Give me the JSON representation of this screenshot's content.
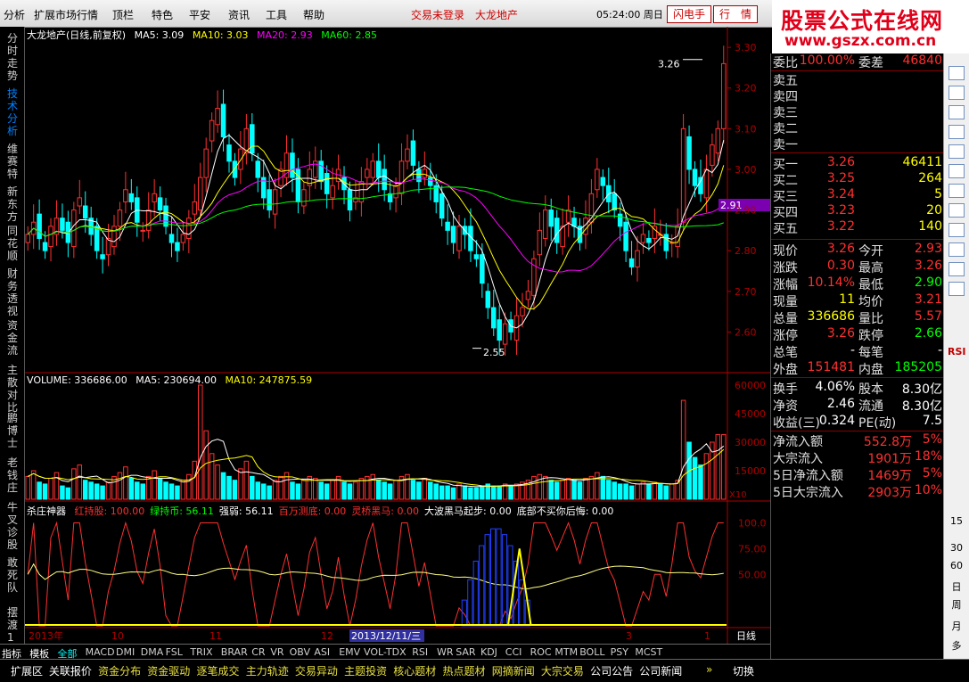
{
  "menu": {
    "items": [
      "分析",
      "扩展市场行情",
      "顶栏",
      "特色",
      "平安",
      "资讯",
      "工具",
      "帮助"
    ],
    "status_not_logged": "交易未登录",
    "stock_name_top": "大龙地产",
    "clock": "05:24:00 周日",
    "btn_flash": "闪电手",
    "btn_quote": "行　情"
  },
  "logo": {
    "cn": "股票公式在线网",
    "url": "www.gszx.com.cn"
  },
  "left_tabs": [
    {
      "label": "分时走势",
      "active": false
    },
    {
      "label": "技术分析",
      "active": true
    },
    {
      "label": "维赛特",
      "active": false
    },
    {
      "label": "新东方",
      "active": false
    },
    {
      "label": "同花顺",
      "active": false
    },
    {
      "label": "财务透视",
      "active": false
    },
    {
      "label": "资金流",
      "active": false
    },
    {
      "label": "主散对比",
      "active": false
    },
    {
      "label": "鹏博士",
      "active": false
    },
    {
      "label": "老钱庄",
      "active": false
    },
    {
      "label": "牛叉诊股",
      "active": false
    },
    {
      "label": "敢死队",
      "active": false
    },
    {
      "label": "摆渡1",
      "active": false
    }
  ],
  "price_panel": {
    "title": "大龙地产(日线,前复权)",
    "ma": [
      {
        "label": "MA5: 3.09",
        "color": "#ffffff"
      },
      {
        "label": "MA10: 3.03",
        "color": "#ffff00"
      },
      {
        "label": "MA20: 2.93",
        "color": "#ff00ff"
      },
      {
        "label": "MA60: 2.85",
        "color": "#00ff00"
      }
    ],
    "axis": [
      "3.30",
      "3.20",
      "3.10",
      "3.00",
      "2.91",
      "2.90",
      "2.80",
      "2.70",
      "2.60"
    ],
    "current": "2.91",
    "high_label": "3.26",
    "low_label": "2.55"
  },
  "volume_panel": {
    "title": "VOLUME: 336686.00",
    "ma5": "MA5: 230694.00",
    "ma10": "MA10: 247875.59",
    "axis": [
      "60000",
      "45000",
      "30000",
      "15000"
    ],
    "unit": "X10"
  },
  "indicator_panel": {
    "title": "杀庄神器",
    "items": [
      {
        "label": "红持股: 100.00",
        "color": "#ff3030"
      },
      {
        "label": "绿持币: 56.11",
        "color": "#00ff00"
      },
      {
        "label": "强弱: 56.11",
        "color": "#ffffff"
      },
      {
        "label": "百万测底: 0.00",
        "color": "#ff3030"
      },
      {
        "label": "灵桥黑马: 0.00",
        "color": "#ff3030"
      },
      {
        "label": "大波黑马起步: 0.00",
        "color": "#ffffff"
      },
      {
        "label": "底部不买你后悔: 0.00",
        "color": "#ffffff"
      }
    ],
    "axis": [
      "100.0",
      "75.00",
      "50.00"
    ]
  },
  "date_axis": {
    "labels": [
      "2013年",
      "10",
      "11",
      "12",
      "2013/12/11/三",
      "3",
      "1"
    ],
    "period": "日线"
  },
  "indicator_tabs": [
    "指标",
    "模板",
    "全部",
    "MACD",
    "DMI",
    "DMA",
    "FSL",
    "TRIX",
    "BRAR",
    "CR",
    "VR",
    "OBV",
    "ASI",
    "EMV",
    "VOL-TDX",
    "RSI",
    "WR",
    "SAR",
    "KDJ",
    "CCI",
    "ROC",
    "MTM",
    "BOLL",
    "PSY",
    "MCST"
  ],
  "info": {
    "sell_ratio": {
      "l1": "委比",
      "v1": "100.00%",
      "l2": "委差",
      "v2": "46840"
    },
    "sells": [
      "卖五",
      "卖四",
      "卖三",
      "卖二",
      "卖一"
    ],
    "buys": [
      {
        "l": "买一",
        "p": "3.26",
        "v": "46411"
      },
      {
        "l": "买二",
        "p": "3.25",
        "v": "264"
      },
      {
        "l": "买三",
        "p": "3.24",
        "v": "5"
      },
      {
        "l": "买四",
        "p": "3.23",
        "v": "20"
      },
      {
        "l": "买五",
        "p": "3.22",
        "v": "140"
      }
    ],
    "stats": [
      {
        "l1": "现价",
        "v1": "3.26",
        "c1": "#ff3030",
        "l2": "今开",
        "v2": "2.93",
        "c2": "#ff3030"
      },
      {
        "l1": "涨跌",
        "v1": "0.30",
        "c1": "#ff3030",
        "l2": "最高",
        "v2": "3.26",
        "c2": "#ff3030"
      },
      {
        "l1": "涨幅",
        "v1": "10.14%",
        "c1": "#ff3030",
        "l2": "最低",
        "v2": "2.90",
        "c2": "#00ff00"
      },
      {
        "l1": "现量",
        "v1": "11",
        "c1": "#ffff00",
        "l2": "均价",
        "v2": "3.21",
        "c2": "#ff3030"
      },
      {
        "l1": "总量",
        "v1": "336686",
        "c1": "#ffff00",
        "l2": "量比",
        "v2": "5.57",
        "c2": "#ff3030"
      },
      {
        "l1": "涨停",
        "v1": "3.26",
        "c1": "#ff3030",
        "l2": "跌停",
        "v2": "2.66",
        "c2": "#00ff00"
      },
      {
        "l1": "总笔",
        "v1": "-",
        "c1": "#ffffff",
        "l2": "每笔",
        "v2": "-",
        "c2": "#ffffff"
      },
      {
        "l1": "外盘",
        "v1": "151481",
        "c1": "#ff3030",
        "l2": "内盘",
        "v2": "185205",
        "c2": "#00ff00"
      }
    ],
    "stats2": [
      {
        "l1": "换手",
        "v1": "4.06%",
        "c1": "#ffffff",
        "l2": "股本",
        "v2": "8.30亿",
        "c2": "#ffffff"
      },
      {
        "l1": "净资",
        "v1": "2.46",
        "c1": "#ffffff",
        "l2": "流通",
        "v2": "8.30亿",
        "c2": "#ffffff"
      },
      {
        "l1": "收益(三)",
        "v1": "0.324",
        "c1": "#ffffff",
        "l2": "PE(动)",
        "v2": "7.5",
        "c2": "#ffffff"
      }
    ],
    "flows": [
      {
        "l": "净流入额",
        "v": "552.8万",
        "p": "5%"
      },
      {
        "l": "大宗流入",
        "v": "1901万",
        "p": "18%"
      },
      {
        "l": "5日净流入额",
        "v": "1469万",
        "p": "5%"
      },
      {
        "l": "5日大宗流入",
        "v": "2903万",
        "p": "10%"
      }
    ],
    "bottom_tabs": [
      "笔",
      "价",
      "细",
      "盘",
      "势",
      "指",
      "值",
      "筹"
    ]
  },
  "right_tools": [
    "RSI",
    "15",
    "30",
    "60",
    "日",
    "周",
    "月",
    "多"
  ],
  "bottom_bar": {
    "items": [
      "扩展区",
      "关联报价",
      "资金分布",
      "资金驱动",
      "逐笔成交",
      "主力轨迹",
      "交易异动",
      "主题投资",
      "核心题材",
      "热点题材",
      "网摘新闻",
      "大宗交易",
      "公司公告",
      "公司新闻"
    ],
    "more": "»",
    "switch": "切换"
  },
  "chart_data": {
    "type": "candlestick",
    "price_range": [
      2.5,
      3.32
    ],
    "closes": [
      2.84,
      2.87,
      2.83,
      2.8,
      2.86,
      2.88,
      2.85,
      2.82,
      2.9,
      2.93,
      2.88,
      2.84,
      2.8,
      2.78,
      2.83,
      2.86,
      2.9,
      2.95,
      2.92,
      2.87,
      2.85,
      2.9,
      2.94,
      2.9,
      2.86,
      2.82,
      2.8,
      2.84,
      2.88,
      2.92,
      2.98,
      3.05,
      3.12,
      3.15,
      3.08,
      3.02,
      2.98,
      3.05,
      3.1,
      3.04,
      2.98,
      2.93,
      2.9,
      2.95,
      3.0,
      3.04,
      2.98,
      2.92,
      2.95,
      3.0,
      3.02,
      2.97,
      2.94,
      2.96,
      3.0,
      2.95,
      2.9,
      2.93,
      2.97,
      3.0,
      3.02,
      2.98,
      2.95,
      2.92,
      2.96,
      3.02,
      3.05,
      3.01,
      2.97,
      3.0,
      2.96,
      2.92,
      2.88,
      2.85,
      2.82,
      2.86,
      2.84,
      2.8,
      2.78,
      2.72,
      2.66,
      2.61,
      2.58,
      2.62,
      2.6,
      2.64,
      2.66,
      2.7,
      2.78,
      2.85,
      2.9,
      2.86,
      2.82,
      2.86,
      2.9,
      2.86,
      2.82,
      2.88,
      2.94,
      3.0,
      2.96,
      2.92,
      2.9,
      2.86,
      2.8,
      2.76,
      2.8,
      2.84,
      2.82,
      2.86,
      2.84,
      2.8,
      2.82,
      2.86,
      3.1,
      3.0,
      2.96,
      2.94,
      3.0,
      3.06,
      3.1,
      3.26
    ],
    "volumes": [
      12000,
      15000,
      9000,
      8000,
      11000,
      14000,
      7000,
      6000,
      16000,
      18000,
      10000,
      9000,
      8000,
      7000,
      9000,
      12000,
      14000,
      17000,
      11000,
      9000,
      8000,
      12000,
      15000,
      11000,
      9000,
      8000,
      7000,
      10000,
      13000,
      20000,
      60000,
      36000,
      24000,
      18000,
      14000,
      12000,
      10000,
      16000,
      20000,
      12000,
      9000,
      8000,
      7000,
      10000,
      12000,
      14000,
      9000,
      8000,
      10000,
      12000,
      11000,
      9000,
      8000,
      10000,
      12000,
      9000,
      8000,
      9000,
      11000,
      12000,
      13000,
      10000,
      9000,
      8000,
      10000,
      12000,
      13000,
      10000,
      9000,
      11000,
      9000,
      8000,
      7000,
      7000,
      6000,
      8000,
      7000,
      6000,
      6000,
      7000,
      8000,
      7000,
      7000,
      8000,
      7000,
      8000,
      9000,
      10000,
      12000,
      13000,
      12000,
      10000,
      9000,
      10000,
      11000,
      10000,
      9000,
      11000,
      12000,
      14000,
      12000,
      10000,
      9000,
      8000,
      8000,
      7000,
      8000,
      9000,
      8000,
      9000,
      8000,
      7000,
      8000,
      10000,
      52000,
      30000,
      22000,
      18000,
      24000,
      30000,
      34000,
      34000
    ]
  }
}
